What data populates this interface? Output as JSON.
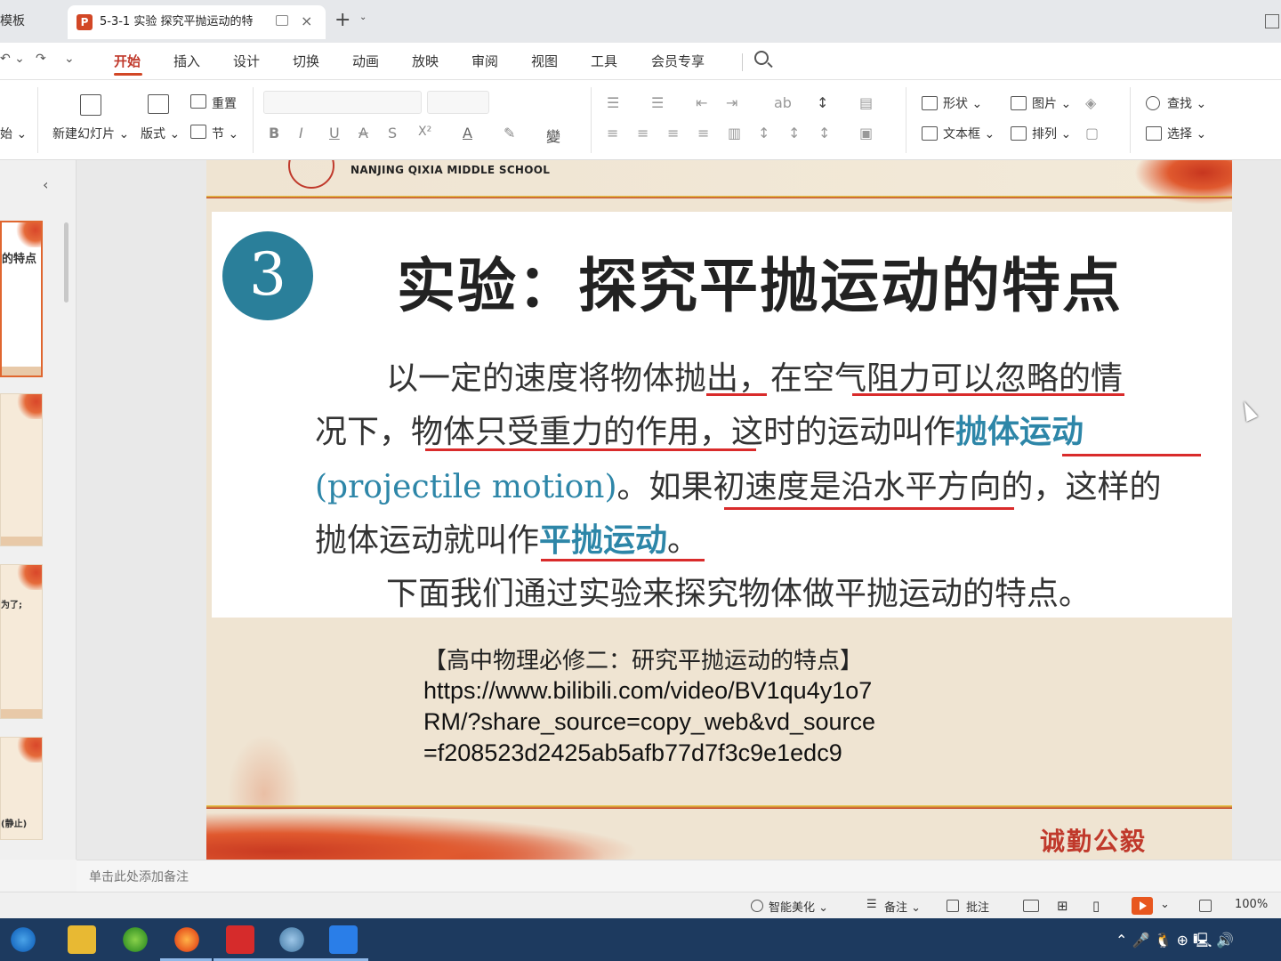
{
  "tabs": {
    "prev_label": "模板",
    "active_title": "5-3-1 实验 探究平抛运动的特",
    "close_glyph": "×",
    "add_glyph": "+",
    "add_caret": "⌄",
    "app_badge": "P"
  },
  "menu": {
    "undo": "↶ ⌄",
    "redo": "↷",
    "more": "⌄",
    "items": [
      "开始",
      "插入",
      "设计",
      "切换",
      "动画",
      "放映",
      "审阅",
      "视图",
      "工具",
      "会员专享"
    ]
  },
  "ribbon": {
    "start_partial": "始 ⌄",
    "new_slide": "新建幻灯片 ⌄",
    "layout": "版式 ⌄",
    "reset": "重置",
    "section": "节 ⌄",
    "format_glyphs": [
      "B",
      "I",
      "U",
      "A",
      "S",
      "X²",
      "A",
      "✎",
      "變"
    ],
    "shape": "形状 ⌄",
    "picture": "图片 ⌄",
    "textbox": "文本框 ⌄",
    "arrange": "排列 ⌄",
    "find": "查找 ⌄",
    "select": "选择 ⌄"
  },
  "left_panel": {
    "collapse_glyph": "‹",
    "thumbs": [
      {
        "title": "的特点"
      },
      {
        "title": ""
      },
      {
        "title": "为了;"
      },
      {
        "title": "(静止)"
      }
    ]
  },
  "slide": {
    "school_name": "NANJING QIXIA MIDDLE SCHOOL",
    "number": "3",
    "title": "实验：探究平抛运动的特点",
    "lines": {
      "l1": "以一定的速度将物体抛出，在空气阻力可以忽略的情",
      "l2a": "况下，物体只受重力的作用，这时的运动叫作",
      "l2b": "抛体运动",
      "l3a": "(projectile motion)",
      "l3b": "。如果初速度是沿水平方向的，这样的",
      "l4a": "抛体运动就叫作",
      "l4b": "平抛运动",
      "l4c": "。",
      "l5": "下面我们通过实验来探究物体做平抛运动的特点。"
    },
    "ref_title": "【高中物理必修二：研究平抛运动的特点】",
    "ref_url_lines": [
      "https://www.bilibili.com/video/BV1qu4y1o7",
      "RM/?share_source=copy_web&vd_source",
      "=f208523d2425ab5afb77d7f3c9e1edc9"
    ],
    "motto": "诚勤公毅"
  },
  "notes": {
    "placeholder": "单击此处添加备注"
  },
  "status": {
    "beautify": "智能美化 ⌄",
    "notes": "备注 ⌄",
    "comments": "批注",
    "zoom": "100%"
  },
  "taskbar": {
    "tray_glyphs": "⌃  🎤  🐧  ⊕  🖳  🔊"
  },
  "colors": {
    "accent": "#d24726",
    "highlight_blue": "#2d86a8",
    "underline_red": "#d92b2b",
    "taskbar": "#1d3a5f"
  }
}
